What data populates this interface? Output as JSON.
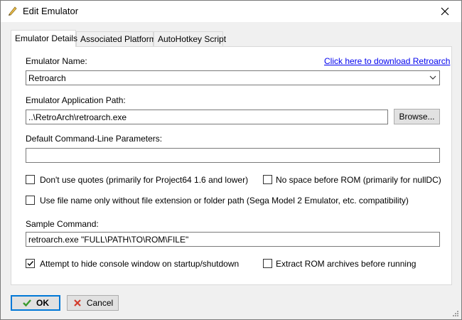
{
  "window": {
    "title": "Edit Emulator"
  },
  "tabs": [
    {
      "label": "Emulator Details",
      "active": true
    },
    {
      "label": "Associated Platforms",
      "active": false
    },
    {
      "label": "AutoHotkey Script",
      "active": false
    }
  ],
  "form": {
    "emulator_name_label": "Emulator Name:",
    "download_link": "Click here to download Retroarch",
    "emulator_name_value": "Retroarch",
    "app_path_label": "Emulator Application Path:",
    "app_path_value": "..\\RetroArch\\retroarch.exe",
    "browse_label": "Browse...",
    "cmdline_label": "Default Command-Line Parameters:",
    "cmdline_value": "",
    "sample_label": "Sample Command:",
    "sample_value": "retroarch.exe \"FULL\\PATH\\TO\\ROM\\FILE\""
  },
  "checkboxes": {
    "no_quotes": {
      "label": "Don't use quotes (primarily for Project64 1.6 and lower)",
      "checked": false
    },
    "no_space": {
      "label": "No space before ROM (primarily for nullDC)",
      "checked": false
    },
    "filename_only": {
      "label": "Use file name only without file extension or folder path (Sega Model 2 Emulator, etc. compatibility)",
      "checked": false
    },
    "hide_console": {
      "label": "Attempt to hide console window on startup/shutdown",
      "checked": true
    },
    "extract_rom": {
      "label": "Extract ROM archives before running",
      "checked": false
    }
  },
  "buttons": {
    "ok": "OK",
    "cancel": "Cancel"
  },
  "icons": {
    "title": "pencil-icon",
    "close": "close-icon",
    "combo": "chevron-down-icon",
    "ok": "checkmark-icon",
    "cancel": "x-icon",
    "grip": "resize-grip-icon"
  },
  "colors": {
    "link": "#0000ee",
    "focus": "#0078d7",
    "ok_check": "#3a9a2e",
    "cancel_x": "#d23a2a"
  }
}
